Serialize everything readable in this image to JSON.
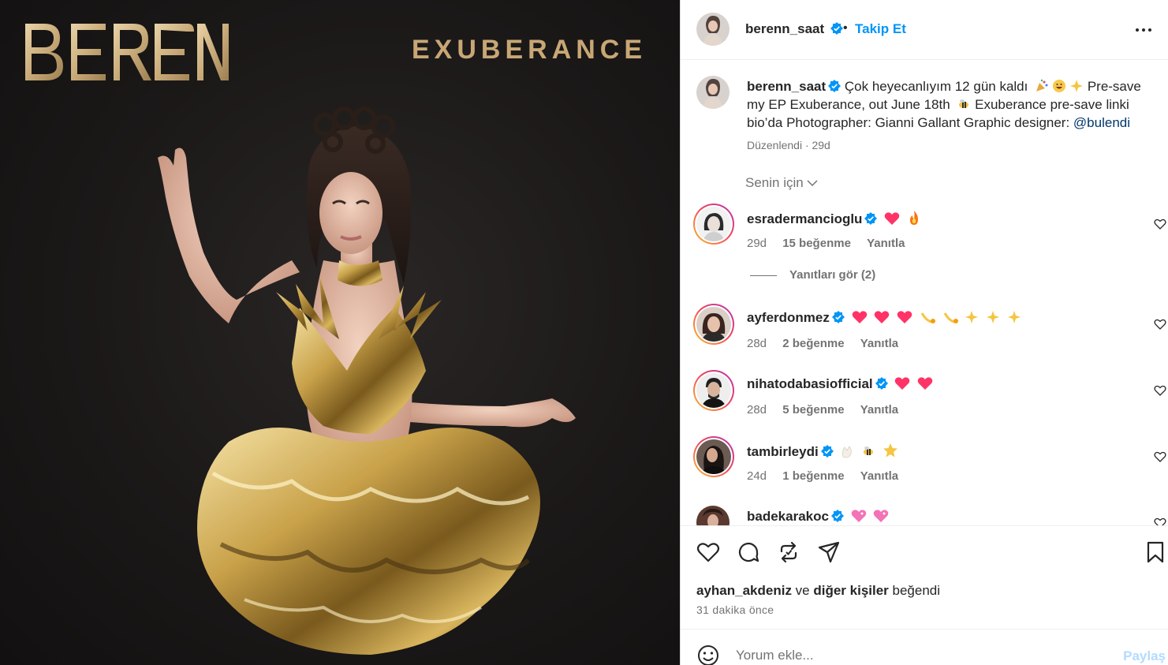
{
  "media": {
    "brand_logo_text": "BEREN",
    "album_title": "EXUBERANCE"
  },
  "post": {
    "author": "berenn_saat",
    "follow_label": "Takip Et",
    "dot": "•",
    "caption": {
      "username": "berenn_saat",
      "text_1": " Çok heyecanlıyım 12 gün kaldı ",
      "text_2": " Pre-save my EP Exuberance, out June 18th ",
      "text_3": " Exuberance pre-save linki bio’da Photographer: Gianni Gallant Graphic designer: ",
      "mention": "@bulendi",
      "meta": "Düzenlendi · 29d"
    },
    "filter_label": "Senin için"
  },
  "comments": [
    {
      "username": "esradermancioglu",
      "time": "29d",
      "likes": "15 beğenme",
      "reply": "Yanıtla",
      "emojis": [
        "heart",
        "fire"
      ]
    },
    {
      "username": "ayferdonmez",
      "time": "28d",
      "likes": "2 beğenme",
      "reply": "Yanıtla",
      "emojis": [
        "heart",
        "heart",
        "heart",
        "comet",
        "comet",
        "sparkles",
        "sparkles",
        "sparkles"
      ]
    },
    {
      "username": "nihatodabasiofficial",
      "time": "28d",
      "likes": "5 beğenme",
      "reply": "Yanıtla",
      "emojis": [
        "heart",
        "heart"
      ]
    },
    {
      "username": "tambirleydi",
      "time": "24d",
      "likes": "1 beğenme",
      "reply": "Yanıtla",
      "emojis": [
        "clap",
        "bee",
        "star"
      ]
    },
    {
      "username": "badekarakoc",
      "time": "",
      "likes": "",
      "reply": "",
      "emojis": [
        "heart2",
        "heart2"
      ]
    }
  ],
  "replies_toggle": "Yanıtları gör (2)",
  "actions": {
    "liked_by_user": "ayhan_akdeniz",
    "liked_by_conj": " ve ",
    "liked_by_others": "diğer kişiler",
    "liked_by_suffix": " beğendi",
    "time_ago": "31 dakika önce"
  },
  "comment_box": {
    "placeholder": "Yorum ekle...",
    "post_label": "Paylaş"
  },
  "colors": {
    "accent_blue": "#0095f6",
    "verified_blue": "#0095f6",
    "gold": "#c8a775",
    "muted_text": "#737373"
  },
  "icons": [
    "more-icon",
    "verified-icon",
    "chevron-down-icon",
    "heart-icon",
    "comment-icon",
    "repost-icon",
    "share-icon",
    "bookmark-icon",
    "emoji-icon"
  ]
}
